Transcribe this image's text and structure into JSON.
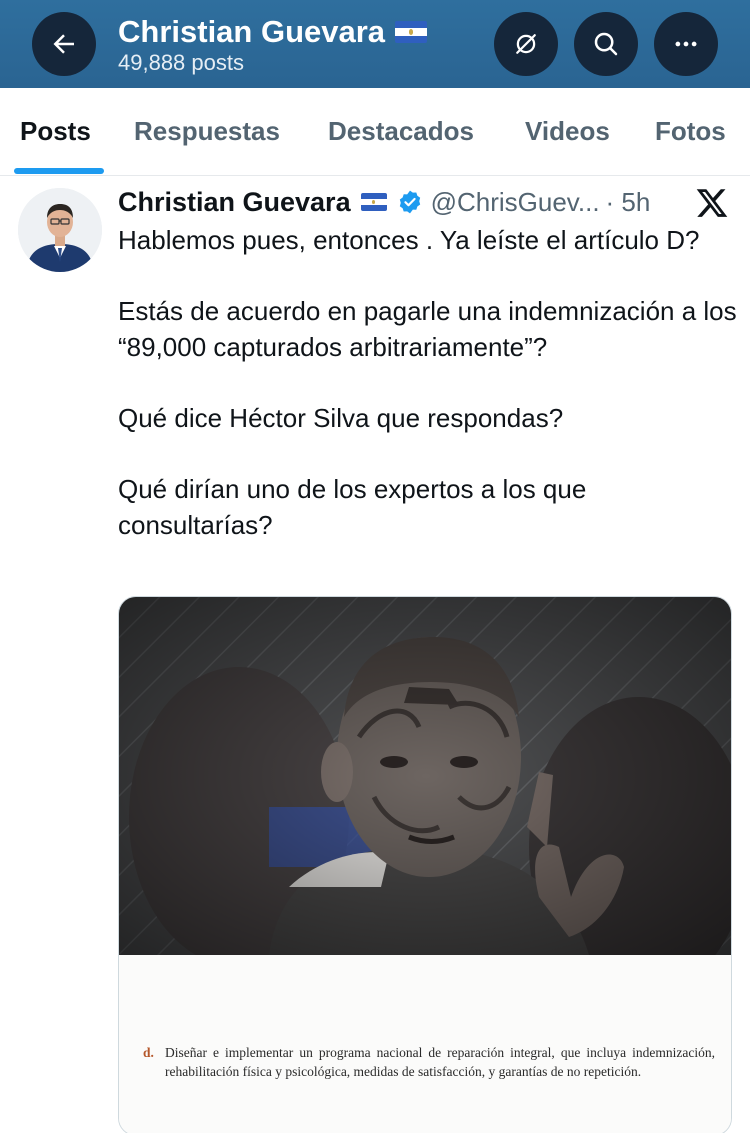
{
  "header": {
    "title": "Christian Guevara",
    "posts_count": "49,888 posts",
    "icons": [
      "back-arrow-icon",
      "grok-icon",
      "search-icon",
      "more-icon"
    ]
  },
  "tabs": [
    {
      "label": "Posts",
      "active": true
    },
    {
      "label": "Respuestas",
      "active": false
    },
    {
      "label": "Destacados",
      "active": false
    },
    {
      "label": "Videos",
      "active": false
    },
    {
      "label": "Fotos",
      "active": false
    }
  ],
  "post": {
    "author_name": "Christian Guevara",
    "handle": "@ChrisGuev...",
    "time": "· 5h",
    "paragraphs": [
      "Hablemos pues, entonces . Ya leíste el artículo D?",
      "Estás de acuerdo en pagarle una indemnización a los “89,000 capturados arbitrariamente”?",
      "Qué dice Héctor Silva que respondas?",
      "Qué dirían uno de los expertos a los que consultarías?"
    ],
    "document": {
      "letter": "d.",
      "text": "Diseñar e implementar un programa nacional de reparación integral, que incluya indemnización, rehabilitación física y psicológica, medidas de satisfacción, y garantías de no repetición."
    }
  },
  "colors": {
    "header_bg": "#2a6492",
    "header_button_bg": "#15263a",
    "accent": "#1d9bf0",
    "secondary_text": "#536471"
  }
}
